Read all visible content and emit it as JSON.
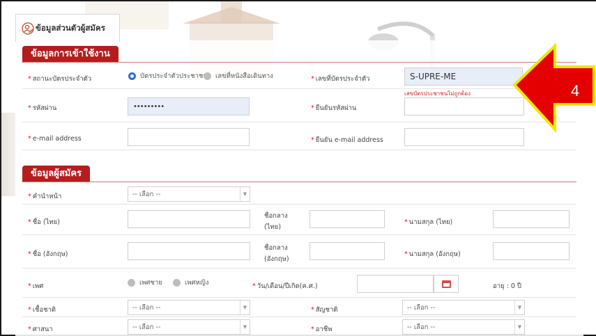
{
  "tab": {
    "label": "ข้อมูลส่วนตัวผู้สมัคร"
  },
  "login": {
    "title": "ข้อมูลการเข้าใช้งาน",
    "id_type": {
      "label": "สถานะบัตรประจำตัว",
      "options": [
        "บัตรประจำตัวประชาชน",
        "เลขที่หนังสือเดินทาง"
      ],
      "selected": "บัตรประจำตัวประชาชน"
    },
    "id_number": {
      "label": "เลขที่บัตรประจำตัว",
      "value": "S-UPRE-ME",
      "error": "เลขบัตรประชาชนไม่ถูกต้อง"
    },
    "password": {
      "label": "รหัสผ่าน",
      "value": "•••••••••"
    },
    "password_confirm": {
      "label": "ยืนยันรหัสผ่าน",
      "value": ""
    },
    "email": {
      "label": "e-mail address",
      "value": ""
    },
    "email_confirm": {
      "label": "ยืนยัน e-mail address",
      "value": ""
    }
  },
  "applicant": {
    "title": "ข้อมูลผู้สมัคร",
    "prefix": {
      "label": "คำนำหน้า",
      "value": "-- เลือก --"
    },
    "name_th": {
      "label": "ชื่อ (ไทย)",
      "middle_label_1": "ชื่อกลาง",
      "middle_label_2": "(ไทย)",
      "surname_label": "นามสกุล (ไทย)"
    },
    "name_en": {
      "label": "ชื่อ (อังกฤษ)",
      "middle_label_1": "ชื่อกลาง",
      "middle_label_2": "(อังกฤษ)",
      "surname_label": "นามสกุล (อังกฤษ)"
    },
    "gender": {
      "label": "เพศ",
      "options": [
        "เพศชาย",
        "เพศหญิง"
      ]
    },
    "birthdate": {
      "label": "วัน/เดือน/ปีเกิด(ค.ศ.)",
      "value": ""
    },
    "age": {
      "text": "อายุ : 0 ปี"
    },
    "ethnicity": {
      "label": "เชื้อชาติ",
      "value": "-- เลือก --"
    },
    "nationality": {
      "label": "สัญชาติ",
      "value": "-- เลือก --"
    },
    "religion": {
      "label": "ศาสนา",
      "value": "-- เลือก --"
    },
    "occupation": {
      "label": "อาชีพ",
      "value": "-- เลือก --"
    }
  },
  "callout": {
    "number": "4",
    "color": "#e40000",
    "outline": "#f2e600"
  },
  "colors": {
    "accent": "#b51d1d",
    "radio_on": "#2b6cd1",
    "error": "#d22222"
  }
}
